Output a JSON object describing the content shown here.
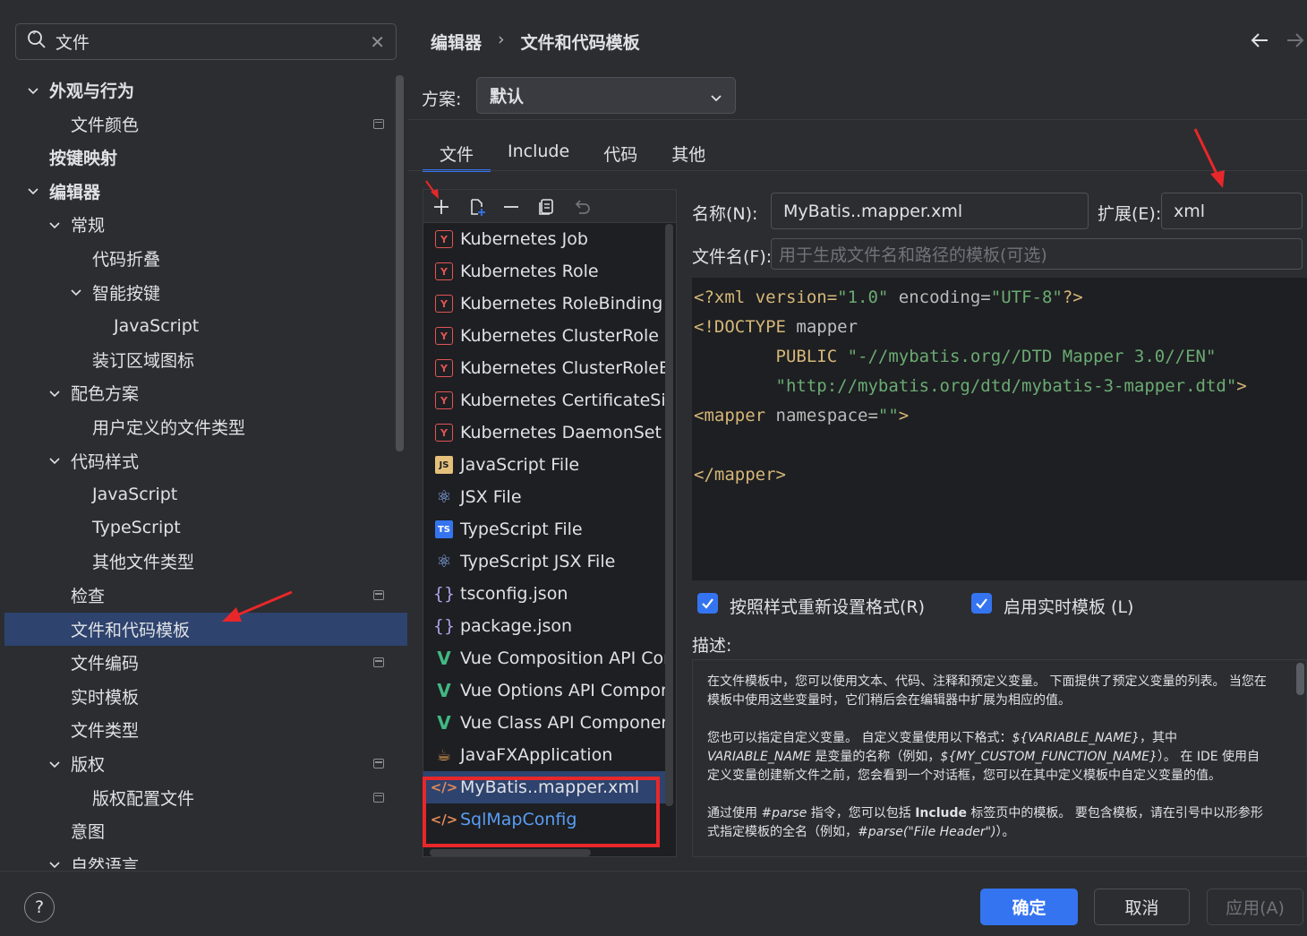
{
  "search": {
    "value": "文件"
  },
  "tree": [
    {
      "label": "外观与行为",
      "bold": true,
      "expanded": true,
      "level": 0
    },
    {
      "label": "文件颜色",
      "level": 1,
      "badge": true
    },
    {
      "label": "按键映射",
      "bold": true,
      "level": 0
    },
    {
      "label": "编辑器",
      "bold": true,
      "expanded": true,
      "level": 0
    },
    {
      "label": "常规",
      "expanded": true,
      "level": 1
    },
    {
      "label": "代码折叠",
      "level": 2
    },
    {
      "label": "智能按键",
      "expanded": true,
      "level": 2
    },
    {
      "label": "JavaScript",
      "level": 3
    },
    {
      "label": "装订区域图标",
      "level": 2
    },
    {
      "label": "配色方案",
      "expanded": true,
      "level": 1
    },
    {
      "label": "用户定义的文件类型",
      "level": 2
    },
    {
      "label": "代码样式",
      "expanded": true,
      "level": 1
    },
    {
      "label": "JavaScript",
      "level": 2
    },
    {
      "label": "TypeScript",
      "level": 2
    },
    {
      "label": "其他文件类型",
      "level": 2
    },
    {
      "label": "检查",
      "level": 1,
      "badge": true
    },
    {
      "label": "文件和代码模板",
      "level": 1,
      "selected": true
    },
    {
      "label": "文件编码",
      "level": 1,
      "badge": true
    },
    {
      "label": "实时模板",
      "level": 1
    },
    {
      "label": "文件类型",
      "level": 1
    },
    {
      "label": "版权",
      "expanded": true,
      "level": 1,
      "badge": true
    },
    {
      "label": "版权配置文件",
      "level": 2,
      "badge": true
    },
    {
      "label": "意图",
      "level": 1
    },
    {
      "label": "自然语言",
      "expanded": true,
      "level": 1
    }
  ],
  "breadcrumb": {
    "parent": "编辑器",
    "separator": "›",
    "current": "文件和代码模板"
  },
  "scheme": {
    "label": "方案:",
    "value": "默认"
  },
  "tabs": [
    "文件",
    "Include",
    "代码",
    "其他"
  ],
  "templates": [
    {
      "name": "Kubernetes Job",
      "icon": "yaml"
    },
    {
      "name": "Kubernetes Role",
      "icon": "yaml"
    },
    {
      "name": "Kubernetes RoleBinding",
      "icon": "yaml"
    },
    {
      "name": "Kubernetes ClusterRole",
      "icon": "yaml"
    },
    {
      "name": "Kubernetes ClusterRoleBindi",
      "icon": "yaml"
    },
    {
      "name": "Kubernetes CertificateSignin",
      "icon": "yaml"
    },
    {
      "name": "Kubernetes DaemonSet",
      "icon": "yaml"
    },
    {
      "name": "JavaScript File",
      "icon": "js"
    },
    {
      "name": "JSX File",
      "icon": "react"
    },
    {
      "name": "TypeScript File",
      "icon": "ts"
    },
    {
      "name": "TypeScript JSX File",
      "icon": "react"
    },
    {
      "name": "tsconfig.json",
      "icon": "json"
    },
    {
      "name": "package.json",
      "icon": "json"
    },
    {
      "name": "Vue Composition API Compo",
      "icon": "vue"
    },
    {
      "name": "Vue Options API Componen",
      "icon": "vue"
    },
    {
      "name": "Vue Class API Component",
      "icon": "vue"
    },
    {
      "name": "JavaFXApplication",
      "icon": "javafx"
    },
    {
      "name": "MyBatis..mapper.xml",
      "icon": "xml",
      "selected": true
    },
    {
      "name": "SqlMapConfig",
      "icon": "xml",
      "highlight": true
    }
  ],
  "icon_glyphs": {
    "yaml": "Y",
    "js": "JS",
    "ts": "TS",
    "json": "{}",
    "vue": "V",
    "xml": "</>",
    "javafx": "☕",
    "react": "⚛"
  },
  "form": {
    "name_label": "名称(N):",
    "name_value": "MyBatis..mapper.xml",
    "ext_label": "扩展(E):",
    "ext_value": "xml",
    "filename_label": "文件名(F):",
    "filename_placeholder": "用于生成文件名和路径的模板(可选)"
  },
  "code": {
    "l1_a": "<?xml version=",
    "l1_b": "\"1.0\"",
    "l1_c": " encoding=",
    "l1_d": "\"UTF-8\"",
    "l1_e": "?>",
    "l2_a": "<!DOCTYPE ",
    "l2_b": "mapper",
    "l3_a": "        PUBLIC ",
    "l3_b": "\"-//mybatis.org//DTD Mapper 3.0//EN\"",
    "l4_a": "        ",
    "l4_b": "\"http://mybatis.org/dtd/mybatis-3-mapper.dtd\"",
    "l4_c": ">",
    "l5_a": "<mapper ",
    "l5_b": "namespace=",
    "l5_c": "\"\"",
    "l5_d": ">",
    "l7": "</mapper>"
  },
  "options": {
    "reformat_label": "按照样式重新设置格式(R)",
    "reformat_checked": true,
    "live_label": "启用实时模板 (L)",
    "live_checked": true
  },
  "description": {
    "label": "描述:",
    "p1": "在文件模板中，您可以使用文本、代码、注释和预定义变量。 下面提供了预定义变量的列表。 当您在模板中使用这些变量时，它们稍后会在编辑器中扩展为相应的值。",
    "p2_a": "您也可以指定自定义变量。 自定义变量使用以下格式：",
    "p2_var": "${VARIABLE_NAME}",
    "p2_b": "，其中 ",
    "p2_var2": "VARIABLE_NAME",
    "p2_c": " 是变量的名称（例如，",
    "p2_var3": "${MY_CUSTOM_FUNCTION_NAME}",
    "p2_d": "）。 在 IDE 使用自定义变量创建新文件之前，您会看到一个对话框，您可以在其中定义模板中自定义变量的值。",
    "p3_a": "通过使用 ",
    "p3_parse": "#parse",
    "p3_b": " 指令，您可以包括 ",
    "p3_include": "Include",
    "p3_c": " 标签页中的模板。 要包含模板，请在引号中以形参形式指定模板的全名（例如，",
    "p3_ex": "#parse(\"File Header\")",
    "p3_d": "）。"
  },
  "footer": {
    "help": "?",
    "ok": "确定",
    "cancel": "取消",
    "apply": "应用(A)"
  },
  "colors": {
    "accent": "#3574f0",
    "selection": "#2e436e",
    "annotation": "#e8272a"
  }
}
